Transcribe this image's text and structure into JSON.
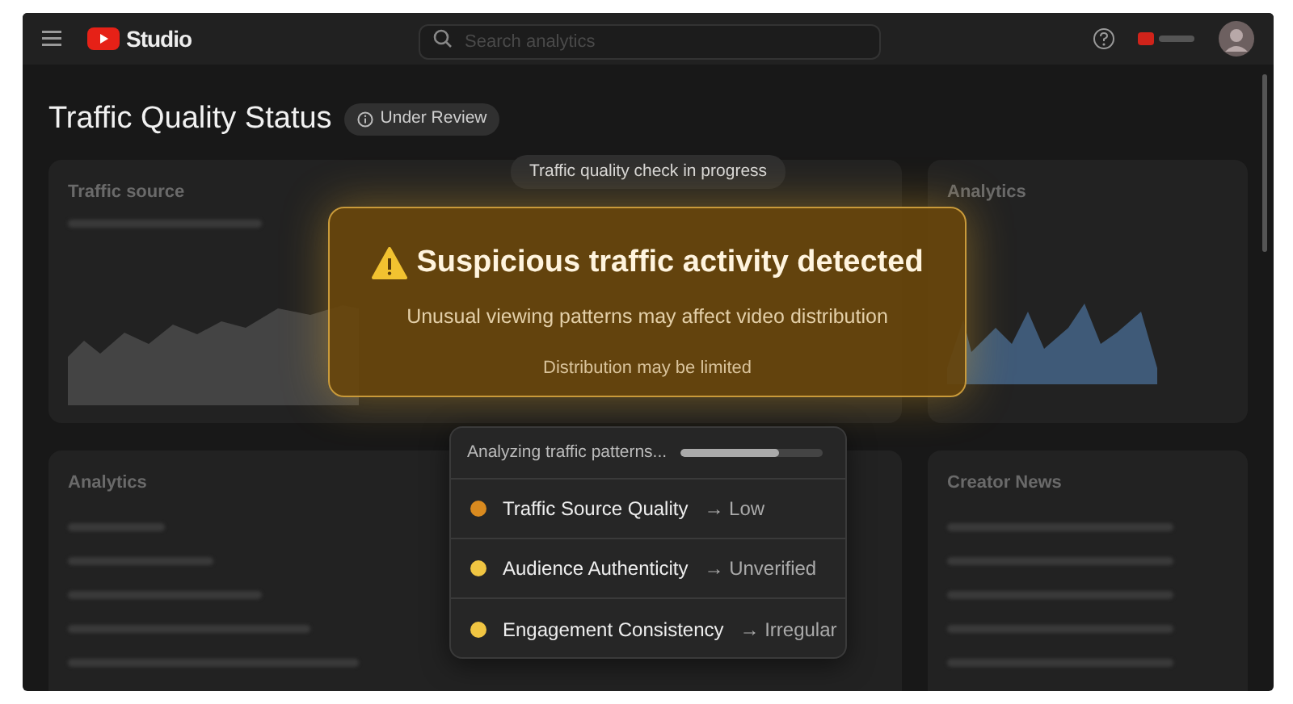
{
  "header": {
    "logo": "Studio",
    "search": {
      "placeholder": "Search analytics"
    }
  },
  "page": {
    "title": "Traffic Quality Status",
    "status_badge": "Under Review"
  },
  "cards": [
    {
      "title": "Traffic source"
    },
    {
      "title": "Analytics"
    },
    {
      "title": "Analytics"
    },
    {
      "title": "Creator News"
    }
  ],
  "progress_pill": "Traffic quality check in progress",
  "alert": {
    "title": "Suspicious traffic activity detected",
    "message": "Unusual viewing patterns may affect video distribution",
    "note": "Distribution may be limited"
  },
  "analysis": {
    "label": "Analyzing traffic patterns...",
    "level": 0.7,
    "checks": [
      {
        "name": "Traffic Source Quality",
        "result": "→ Low",
        "color": "#d98a1f"
      },
      {
        "name": "Audience Authenticity",
        "result": "→ Unverified",
        "color": "#f0c542"
      },
      {
        "name": "Engagement Consistency",
        "result": "→ Irregular",
        "color": "#f0c542"
      }
    ]
  }
}
